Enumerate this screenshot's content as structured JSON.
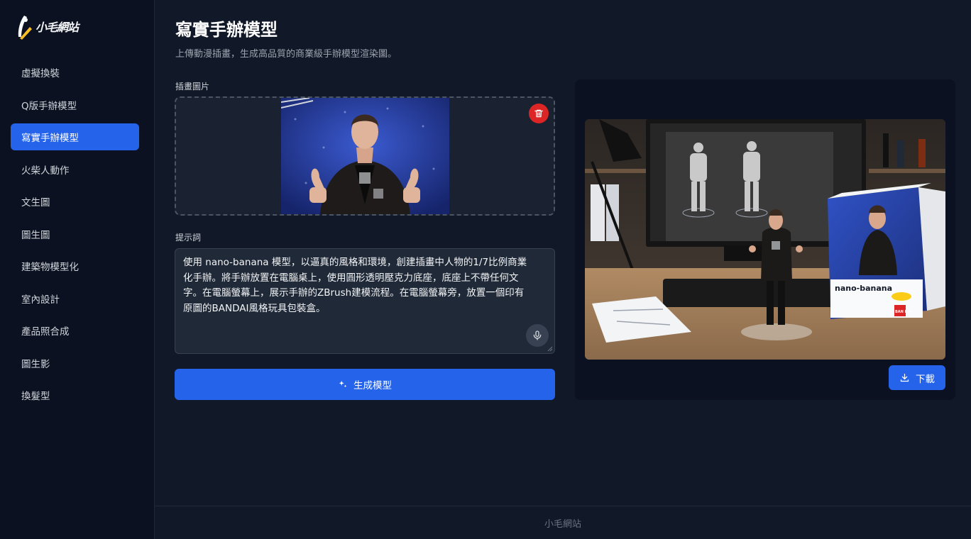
{
  "app": {
    "logo_text": "小毛網站"
  },
  "sidebar": {
    "items": [
      {
        "label": "虛擬換裝",
        "active": false
      },
      {
        "label": "Q版手辦模型",
        "active": false
      },
      {
        "label": "寫實手辦模型",
        "active": true
      },
      {
        "label": "火柴人動作",
        "active": false
      },
      {
        "label": "文生圖",
        "active": false
      },
      {
        "label": "圖生圖",
        "active": false
      },
      {
        "label": "建築物模型化",
        "active": false
      },
      {
        "label": "室內設計",
        "active": false
      },
      {
        "label": "產品照合成",
        "active": false
      },
      {
        "label": "圖生影",
        "active": false
      },
      {
        "label": "換髮型",
        "active": false
      }
    ]
  },
  "main": {
    "title": "寫實手辦模型",
    "subtitle": "上傳動漫插畫，生成高品質的商業級手辦模型渲染圖。",
    "upload_label": "插畫圖片",
    "prompt_label": "提示詞",
    "prompt_text": "使用 nano-banana 模型，以逼真的風格和環境，創建插畫中人物的1/7比例商業化手辦。將手辦放置在電腦桌上，使用圓形透明壓克力底座，底座上不帶任何文字。在電腦螢幕上，展示手辦的ZBrush建模流程。在電腦螢幕旁，放置一個印有原圖的BANDAI風格玩具包裝盒。",
    "generate_label": "生成模型",
    "download_label": "下載",
    "box_brand_text": "nano-banana",
    "box_maker_text": "BAN DAI"
  },
  "footer": {
    "text": "小毛網站"
  },
  "colors": {
    "accent": "#2563eb",
    "danger": "#dc2626",
    "sidebar_bg": "#0b1120",
    "main_bg": "#111827"
  },
  "icons": {
    "delete": "trash-icon",
    "mic": "microphone-icon",
    "generate": "sparkles-icon",
    "download": "download-icon"
  }
}
